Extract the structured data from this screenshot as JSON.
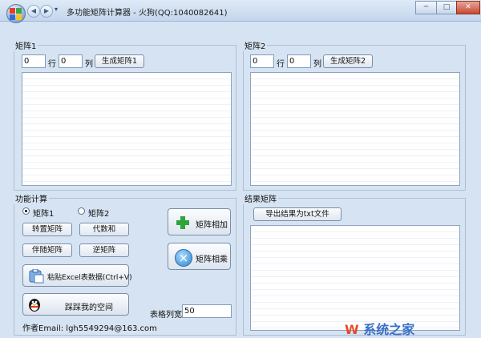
{
  "window": {
    "title": "多功能矩阵计算器 - 火狗(QQ:1040082641)",
    "back_glyph": "◀",
    "forward_glyph": "▶",
    "menu_glyph": "▾",
    "minimize": "─",
    "maximize": "□",
    "close": "✕"
  },
  "matrix1": {
    "label": "矩阵1",
    "rows_value": "0",
    "rows_label": "行",
    "cols_value": "0",
    "cols_label": "列",
    "generate_button": "生成矩阵1"
  },
  "matrix2": {
    "label": "矩阵2",
    "rows_value": "0",
    "rows_label": "行",
    "cols_value": "0",
    "cols_label": "列",
    "generate_button": "生成矩阵2"
  },
  "functions": {
    "label": "功能计算",
    "radio_options": [
      "矩阵1",
      "矩阵2"
    ],
    "selected_radio": "矩阵1",
    "transpose_button": "转置矩阵",
    "cofactor_button": "代数和",
    "adjugate_button": "伴随矩阵",
    "inverse_button": "逆矩阵",
    "add_button": "矩阵相加",
    "multiply_button": "矩阵相乘",
    "paste_excel_button": "粘贴Excel表数据(Ctrl+V)",
    "visit_space_button": "踩踩我的空间",
    "column_width_label": "表格列宽",
    "column_width_value": "50",
    "author_email": "作者Email: lgh5549294@163.com"
  },
  "result": {
    "label": "结果矩阵",
    "export_button": "导出结果为txt文件"
  },
  "watermark": {
    "brand_w": "W",
    "brand_text": "系统之家"
  },
  "colors": {
    "window_bg": "#d6e3f2",
    "plus_icon": "#2fa43a",
    "multiply_icon": "#2f84d2",
    "close_button": "#c74a34"
  },
  "icons": [
    "app-icon",
    "back-icon",
    "forward-icon",
    "dropdown-icon",
    "plus-icon",
    "multiply-icon",
    "paste-icon",
    "qq-penguin-icon"
  ]
}
